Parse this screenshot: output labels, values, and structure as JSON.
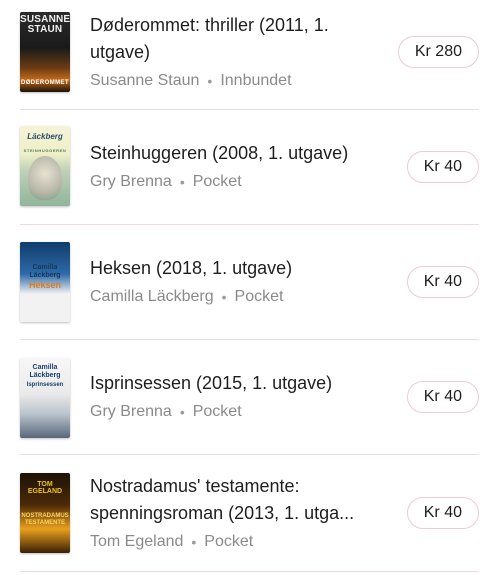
{
  "items": [
    {
      "title": "Døderommet: thriller (2011, 1. utgave)",
      "author": "Susanne Staun",
      "format": "Innbundet",
      "price": "Kr 280",
      "cover": {
        "author_text": "SUSANNE STAUN",
        "title_text": "DØDEROMMET"
      }
    },
    {
      "title": "Steinhuggeren (2008, 1. utgave)",
      "author": "Gry Brenna",
      "format": "Pocket",
      "price": "Kr 40",
      "cover": {
        "author_text": "Läckberg",
        "title_text": "STEINHUGGEREN"
      }
    },
    {
      "title": "Heksen (2018, 1. utgave)",
      "author": "Camilla Läckberg",
      "format": "Pocket",
      "price": "Kr 40",
      "cover": {
        "author_text": "Camilla Läckberg",
        "title_text": "Heksen"
      }
    },
    {
      "title": "Isprinsessen (2015, 1. utgave)",
      "author": "Gry Brenna",
      "format": "Pocket",
      "price": "Kr 40",
      "cover": {
        "author_text": "Camilla Läckberg",
        "title_text": "Isprinsessen"
      }
    },
    {
      "title": "Nostradamus' testamente: spenningsroman (2013, 1. utga...",
      "author": "Tom Egeland",
      "format": "Pocket",
      "price": "Kr 40",
      "cover": {
        "author_text": "TOM EGELAND",
        "title_text": "NOSTRADAMUS TESTAMENTE"
      }
    }
  ],
  "separator": "•",
  "colors": {
    "price_border": "#f2c9d3",
    "divider": "#f1dbe0",
    "meta_text": "#8a8a8a",
    "title_text": "#1e1e1e"
  }
}
